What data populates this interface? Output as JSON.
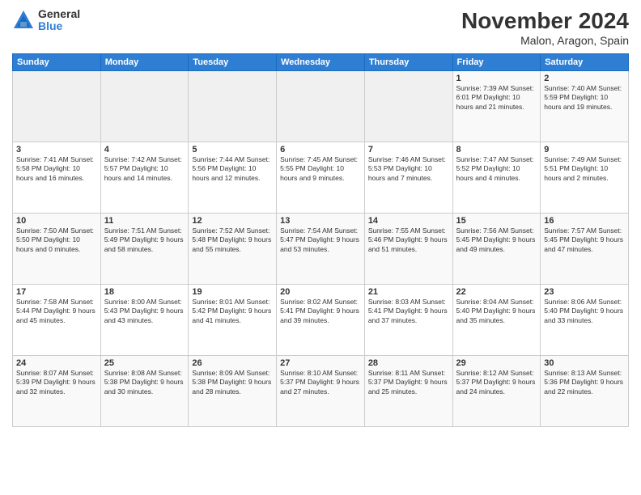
{
  "logo": {
    "general": "General",
    "blue": "Blue"
  },
  "title": "November 2024",
  "subtitle": "Malon, Aragon, Spain",
  "weekdays": [
    "Sunday",
    "Monday",
    "Tuesday",
    "Wednesday",
    "Thursday",
    "Friday",
    "Saturday"
  ],
  "weeks": [
    [
      {
        "day": "",
        "info": ""
      },
      {
        "day": "",
        "info": ""
      },
      {
        "day": "",
        "info": ""
      },
      {
        "day": "",
        "info": ""
      },
      {
        "day": "",
        "info": ""
      },
      {
        "day": "1",
        "info": "Sunrise: 7:39 AM\nSunset: 6:01 PM\nDaylight: 10 hours and 21 minutes."
      },
      {
        "day": "2",
        "info": "Sunrise: 7:40 AM\nSunset: 5:59 PM\nDaylight: 10 hours and 19 minutes."
      }
    ],
    [
      {
        "day": "3",
        "info": "Sunrise: 7:41 AM\nSunset: 5:58 PM\nDaylight: 10 hours and 16 minutes."
      },
      {
        "day": "4",
        "info": "Sunrise: 7:42 AM\nSunset: 5:57 PM\nDaylight: 10 hours and 14 minutes."
      },
      {
        "day": "5",
        "info": "Sunrise: 7:44 AM\nSunset: 5:56 PM\nDaylight: 10 hours and 12 minutes."
      },
      {
        "day": "6",
        "info": "Sunrise: 7:45 AM\nSunset: 5:55 PM\nDaylight: 10 hours and 9 minutes."
      },
      {
        "day": "7",
        "info": "Sunrise: 7:46 AM\nSunset: 5:53 PM\nDaylight: 10 hours and 7 minutes."
      },
      {
        "day": "8",
        "info": "Sunrise: 7:47 AM\nSunset: 5:52 PM\nDaylight: 10 hours and 4 minutes."
      },
      {
        "day": "9",
        "info": "Sunrise: 7:49 AM\nSunset: 5:51 PM\nDaylight: 10 hours and 2 minutes."
      }
    ],
    [
      {
        "day": "10",
        "info": "Sunrise: 7:50 AM\nSunset: 5:50 PM\nDaylight: 10 hours and 0 minutes."
      },
      {
        "day": "11",
        "info": "Sunrise: 7:51 AM\nSunset: 5:49 PM\nDaylight: 9 hours and 58 minutes."
      },
      {
        "day": "12",
        "info": "Sunrise: 7:52 AM\nSunset: 5:48 PM\nDaylight: 9 hours and 55 minutes."
      },
      {
        "day": "13",
        "info": "Sunrise: 7:54 AM\nSunset: 5:47 PM\nDaylight: 9 hours and 53 minutes."
      },
      {
        "day": "14",
        "info": "Sunrise: 7:55 AM\nSunset: 5:46 PM\nDaylight: 9 hours and 51 minutes."
      },
      {
        "day": "15",
        "info": "Sunrise: 7:56 AM\nSunset: 5:45 PM\nDaylight: 9 hours and 49 minutes."
      },
      {
        "day": "16",
        "info": "Sunrise: 7:57 AM\nSunset: 5:45 PM\nDaylight: 9 hours and 47 minutes."
      }
    ],
    [
      {
        "day": "17",
        "info": "Sunrise: 7:58 AM\nSunset: 5:44 PM\nDaylight: 9 hours and 45 minutes."
      },
      {
        "day": "18",
        "info": "Sunrise: 8:00 AM\nSunset: 5:43 PM\nDaylight: 9 hours and 43 minutes."
      },
      {
        "day": "19",
        "info": "Sunrise: 8:01 AM\nSunset: 5:42 PM\nDaylight: 9 hours and 41 minutes."
      },
      {
        "day": "20",
        "info": "Sunrise: 8:02 AM\nSunset: 5:41 PM\nDaylight: 9 hours and 39 minutes."
      },
      {
        "day": "21",
        "info": "Sunrise: 8:03 AM\nSunset: 5:41 PM\nDaylight: 9 hours and 37 minutes."
      },
      {
        "day": "22",
        "info": "Sunrise: 8:04 AM\nSunset: 5:40 PM\nDaylight: 9 hours and 35 minutes."
      },
      {
        "day": "23",
        "info": "Sunrise: 8:06 AM\nSunset: 5:40 PM\nDaylight: 9 hours and 33 minutes."
      }
    ],
    [
      {
        "day": "24",
        "info": "Sunrise: 8:07 AM\nSunset: 5:39 PM\nDaylight: 9 hours and 32 minutes."
      },
      {
        "day": "25",
        "info": "Sunrise: 8:08 AM\nSunset: 5:38 PM\nDaylight: 9 hours and 30 minutes."
      },
      {
        "day": "26",
        "info": "Sunrise: 8:09 AM\nSunset: 5:38 PM\nDaylight: 9 hours and 28 minutes."
      },
      {
        "day": "27",
        "info": "Sunrise: 8:10 AM\nSunset: 5:37 PM\nDaylight: 9 hours and 27 minutes."
      },
      {
        "day": "28",
        "info": "Sunrise: 8:11 AM\nSunset: 5:37 PM\nDaylight: 9 hours and 25 minutes."
      },
      {
        "day": "29",
        "info": "Sunrise: 8:12 AM\nSunset: 5:37 PM\nDaylight: 9 hours and 24 minutes."
      },
      {
        "day": "30",
        "info": "Sunrise: 8:13 AM\nSunset: 5:36 PM\nDaylight: 9 hours and 22 minutes."
      }
    ]
  ]
}
